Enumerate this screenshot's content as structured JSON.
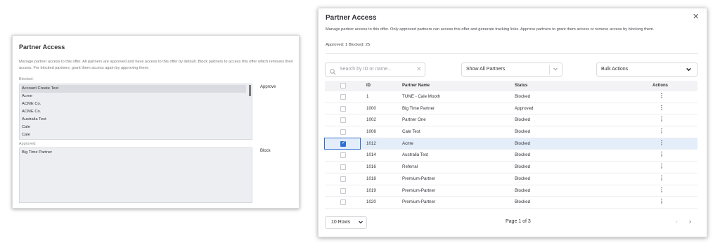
{
  "old_panel": {
    "title": "Partner Access",
    "description": "Manage partner access to this offer. All partners are approved and have access to this offer by default. Block partners to access this offer which removes their access. For blocked partners, grant them access again by approving them.",
    "blocked_label": "Blocked:",
    "blocked_items": [
      "Account Create Test",
      "Acme",
      "ACME Co.",
      "ACME Co.",
      "Australia Test",
      "Cale",
      "Cale"
    ],
    "approve_label": "Approve",
    "approved_label": "Approved:",
    "approved_items": [
      "Big Time Partner"
    ],
    "block_label": "Block"
  },
  "modal": {
    "title": "Partner Access",
    "close_glyph": "✕",
    "description": "Manage partner access to this offer. Only approved partners can access this offer and generate tracking links. Approve partners to grant them access or remove access by blocking them.",
    "counts": "Approved: 1  Blocked: 25",
    "search": {
      "placeholder": "Search by ID or name...",
      "clear_glyph": "✕"
    },
    "partner_filter": {
      "value": "Show All Partners"
    },
    "bulk_actions": {
      "value": "Bulk Actions"
    },
    "table": {
      "headers": {
        "id": "ID",
        "name": "Partner Name",
        "status": "Status",
        "actions": "Actions"
      },
      "rows": [
        {
          "id": "1",
          "name": "TUNE - Cale Mooth",
          "status": "Blocked",
          "selected": false
        },
        {
          "id": "1000",
          "name": "Big Time Partner",
          "status": "Approved",
          "selected": false
        },
        {
          "id": "1002",
          "name": "Partner One",
          "status": "Blocked",
          "selected": false
        },
        {
          "id": "1008",
          "name": "Cale Test",
          "status": "Blocked",
          "selected": false
        },
        {
          "id": "1012",
          "name": "Acme",
          "status": "Blocked",
          "selected": true
        },
        {
          "id": "1014",
          "name": "Australia Test",
          "status": "Blocked",
          "selected": false
        },
        {
          "id": "1016",
          "name": "Referral",
          "status": "Blocked",
          "selected": false
        },
        {
          "id": "1018",
          "name": "Premium-Partner",
          "status": "Blocked",
          "selected": false
        },
        {
          "id": "1019",
          "name": "Premium-Partner",
          "status": "Blocked",
          "selected": false
        },
        {
          "id": "1020",
          "name": "Premium-Partner",
          "status": "Blocked",
          "selected": false
        }
      ],
      "actions_glyph": "⋮"
    },
    "pagination": {
      "rows_value": "10 Rows",
      "page_label": "Page 1 of 3",
      "prev_glyph": "‹",
      "next_glyph": "›"
    }
  },
  "icons": {
    "search": "search-icon",
    "chevron_down": "chevron-down-icon",
    "close": "close-icon",
    "kebab": "kebab-menu-icon",
    "check": "check-icon"
  },
  "colors": {
    "accent": "#2f6fd0",
    "selected_row": "#e4eefb",
    "old_list_bg": "#eceef2"
  }
}
